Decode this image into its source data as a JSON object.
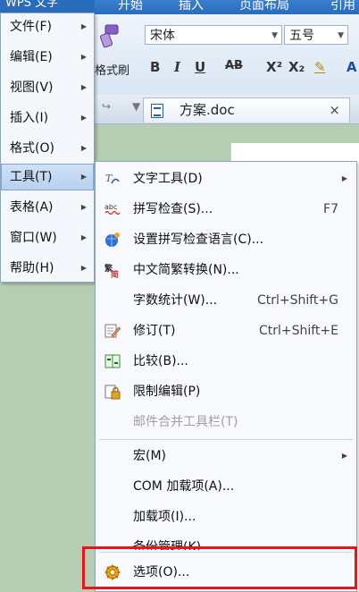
{
  "app": {
    "title": "WPS 文字",
    "ribbon_tabs": [
      "开始",
      "插入",
      "页面布局",
      "引用"
    ]
  },
  "ribbon": {
    "font_name": "宋体",
    "font_size": "五号",
    "format_painter_label": "格式刷",
    "format_buttons": [
      "B",
      "I",
      "U",
      "AB",
      "X²",
      "X₂",
      "A"
    ]
  },
  "document_tab": {
    "name": "方案.doc",
    "close_glyph": "×"
  },
  "main_menu": {
    "items": [
      {
        "label": "文件(F)"
      },
      {
        "label": "编辑(E)"
      },
      {
        "label": "视图(V)"
      },
      {
        "label": "插入(I)"
      },
      {
        "label": "格式(O)"
      },
      {
        "label": "工具(T)"
      },
      {
        "label": "表格(A)"
      },
      {
        "label": "窗口(W)"
      },
      {
        "label": "帮助(H)"
      }
    ],
    "active_item": "工具(T)"
  },
  "tools_menu": {
    "items": [
      {
        "label": "文字工具(D)",
        "shortcut": "",
        "icon": "text-tool-icon",
        "submenu": true
      },
      {
        "label": "拼写检查(S)...",
        "shortcut": "F7",
        "icon": "spellcheck-icon",
        "submenu": false
      },
      {
        "label": "设置拼写检查语言(C)...",
        "shortcut": "",
        "icon": "spell-language-icon",
        "submenu": false
      },
      {
        "label": "中文简繁转换(N)...",
        "shortcut": "",
        "icon": "chinese-convert-icon",
        "submenu": false
      },
      {
        "label": "字数统计(W)...",
        "shortcut": "Ctrl+Shift+G",
        "icon": "",
        "submenu": false
      },
      {
        "label": "修订(T)",
        "shortcut": "Ctrl+Shift+E",
        "icon": "revision-icon",
        "submenu": false
      },
      {
        "label": "比较(B)...",
        "shortcut": "",
        "icon": "compare-icon",
        "submenu": false
      },
      {
        "label": "限制编辑(P)",
        "shortcut": "",
        "icon": "lock-icon",
        "submenu": false
      },
      {
        "label": "邮件合并工具栏(T)",
        "shortcut": "",
        "icon": "",
        "submenu": false,
        "disabled": true
      },
      {
        "label": "宏(M)",
        "shortcut": "",
        "icon": "",
        "submenu": true
      },
      {
        "label": "COM 加载项(A)...",
        "shortcut": "",
        "icon": "",
        "submenu": false
      },
      {
        "label": "加载项(I)...",
        "shortcut": "",
        "icon": "",
        "submenu": false
      },
      {
        "label": "备份管理(K)",
        "shortcut": "",
        "icon": "",
        "submenu": false
      },
      {
        "label": "选项(O)...",
        "shortcut": "",
        "icon": "gear-icon",
        "submenu": false
      }
    ]
  },
  "colors": {
    "highlight_box": "#e8141a",
    "active_item_bg": "#b6d0ef",
    "title_bar": "#2a6bbd"
  }
}
